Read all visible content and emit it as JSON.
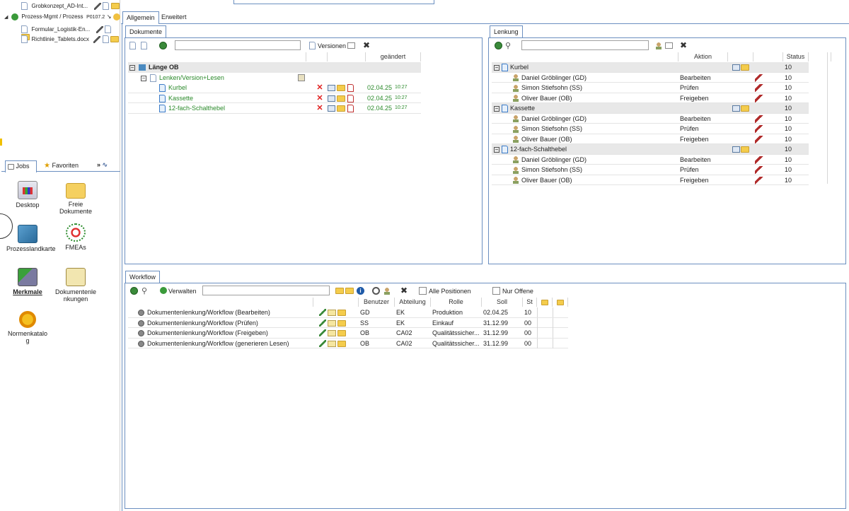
{
  "tree": {
    "items": [
      {
        "label": "Grobkonzept_AD-Int...",
        "indent": 2
      },
      {
        "label": "Prozess-Mgmt / Prozess",
        "suffix": "P0107.2",
        "indent": 1
      },
      {
        "label": "Formular_Logistik-En...",
        "indent": 2
      },
      {
        "label": "Richtlinie_Tablets.docx",
        "indent": 2
      }
    ]
  },
  "jobs": {
    "tabs": {
      "jobs": "Jobs",
      "favoriten": "Favoriten",
      "more": "»"
    },
    "tiles": [
      {
        "label": "Desktop"
      },
      {
        "label": "Freie Dokumente"
      },
      {
        "label": "Prozesslandkarte"
      },
      {
        "label": "FMEAs"
      },
      {
        "label": "Merkmale"
      },
      {
        "label": "Dokumentenlenkungen"
      },
      {
        "label": "Normenkatalog"
      }
    ]
  },
  "main_tabs": {
    "allgemein": "Allgemein",
    "erweitert": "Erweitert"
  },
  "dokumente": {
    "title": "Dokumente",
    "versionen": "Versionen",
    "col_geaendert": "geändert",
    "root": "Länge OB",
    "group": "Lenken/Version+Lesen",
    "rows": [
      {
        "name": "Kurbel",
        "date": "02.04.25",
        "time": "10:27"
      },
      {
        "name": "Kassette",
        "date": "02.04.25",
        "time": "10:27"
      },
      {
        "name": "12-fach-Schalthebel",
        "date": "02.04.25",
        "time": "10:27"
      }
    ]
  },
  "lenkung": {
    "title": "Lenkung",
    "col_aktion": "Aktion",
    "col_status": "Status",
    "groups": [
      {
        "name": "Kurbel",
        "status": "10",
        "rows": [
          {
            "user": "Daniel Gröblinger (GD)",
            "aktion": "Bearbeiten",
            "status": "10"
          },
          {
            "user": "Simon Stiefsohn (SS)",
            "aktion": "Prüfen",
            "status": "10"
          },
          {
            "user": "Oliver Bauer (OB)",
            "aktion": "Freigeben",
            "status": "10"
          }
        ]
      },
      {
        "name": "Kassette",
        "status": "10",
        "rows": [
          {
            "user": "Daniel Gröblinger (GD)",
            "aktion": "Bearbeiten",
            "status": "10"
          },
          {
            "user": "Simon Stiefsohn (SS)",
            "aktion": "Prüfen",
            "status": "10"
          },
          {
            "user": "Oliver Bauer (OB)",
            "aktion": "Freigeben",
            "status": "10"
          }
        ]
      },
      {
        "name": "12-fach-Schalthebel",
        "status": "10",
        "rows": [
          {
            "user": "Daniel Gröblinger (GD)",
            "aktion": "Bearbeiten",
            "status": "10"
          },
          {
            "user": "Simon Stiefsohn (SS)",
            "aktion": "Prüfen",
            "status": "10"
          },
          {
            "user": "Oliver Bauer (OB)",
            "aktion": "Freigeben",
            "status": "10"
          }
        ]
      }
    ]
  },
  "workflow": {
    "title": "Workflow",
    "verwalten": "Verwalten",
    "alle_positionen": "Alle Positionen",
    "nur_offene": "Nur Offene",
    "columns": {
      "benutzer": "Benutzer",
      "abteilung": "Abteilung",
      "rolle": "Rolle",
      "soll": "Soll",
      "st": "St"
    },
    "rows": [
      {
        "name": "Dokumentenlenkung/Workflow (Bearbeiten)",
        "benutzer": "GD",
        "abteilung": "EK",
        "rolle": "Produktion",
        "soll": "02.04.25",
        "st": "10"
      },
      {
        "name": "Dokumentenlenkung/Workflow (Prüfen)",
        "benutzer": "SS",
        "abteilung": "EK",
        "rolle": "Einkauf",
        "soll": "31.12.99",
        "st": "00"
      },
      {
        "name": "Dokumentenlenkung/Workflow (Freigeben)",
        "benutzer": "OB",
        "abteilung": "CA02",
        "rolle": "Qualitätssicher...",
        "soll": "31.12.99",
        "st": "00"
      },
      {
        "name": "Dokumentenlenkung/Workflow (generieren Lesen)",
        "benutzer": "OB",
        "abteilung": "CA02",
        "rolle": "Qualitätssicher...",
        "soll": "31.12.99",
        "st": "00"
      }
    ]
  }
}
